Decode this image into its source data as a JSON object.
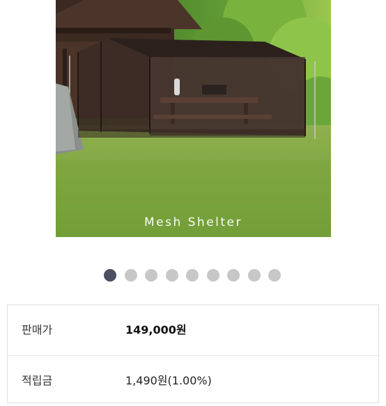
{
  "product_image": {
    "caption": "Mesh Shelter",
    "carousel": {
      "total": 9,
      "active_index": 0
    }
  },
  "info": {
    "price": {
      "label": "판매가",
      "value": "149,000원"
    },
    "points": {
      "label": "적립금",
      "value": "1,490원(1.00%)"
    }
  },
  "colors": {
    "dot_active": "#4a4f62",
    "dot_inactive": "#c7c7c7"
  }
}
